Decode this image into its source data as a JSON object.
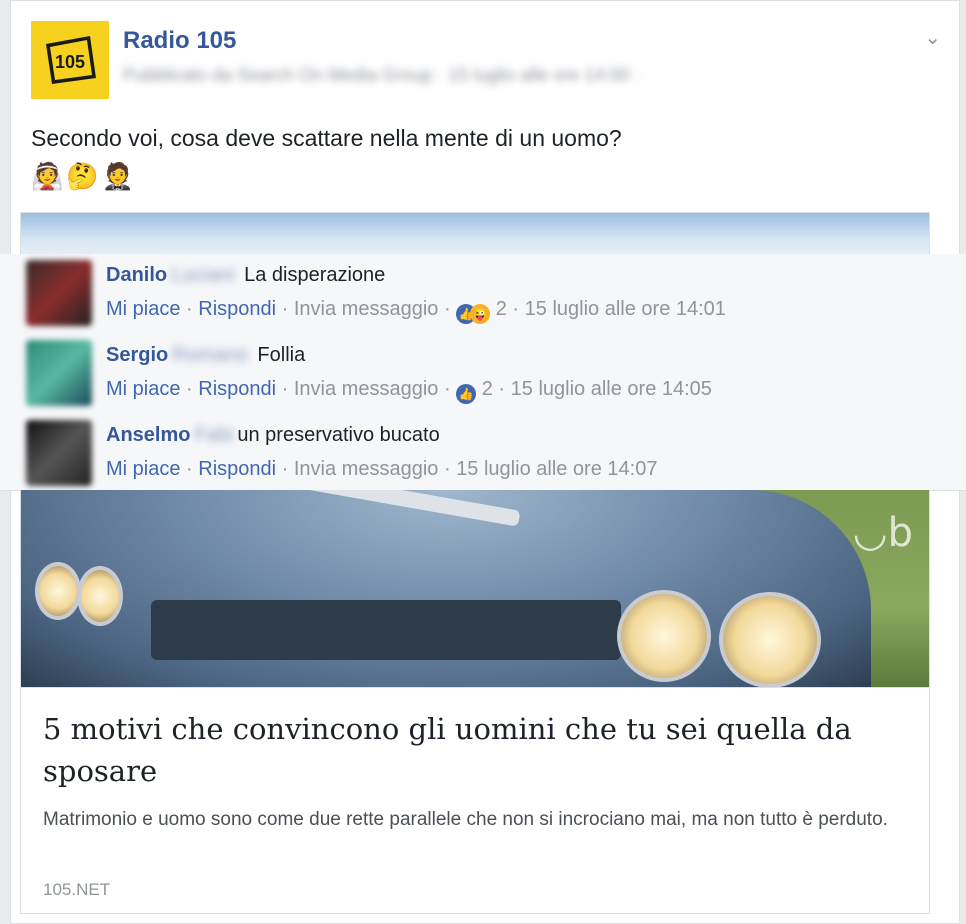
{
  "post": {
    "page_name": "Radio 105",
    "meta_text": "Pubblicato da Search On Media Group · 15 luglio alle ore 14:00 ·",
    "logo_text": "105",
    "text": "Secondo voi, cosa deve scattare nella mente di un uomo?",
    "emojis": "👰🤔🤵"
  },
  "comments": [
    {
      "author": "Danilo",
      "author_hidden": "Luciani",
      "text": "La disperazione",
      "actions": [
        "Mi piace",
        "Rispondi",
        "Invia messaggio"
      ],
      "reaction_count": "2",
      "time": "15 luglio alle ore 14:01"
    },
    {
      "author": "Sergio",
      "author_hidden": "Romano",
      "text": "Follia",
      "actions": [
        "Mi piace",
        "Rispondi",
        "Invia messaggio"
      ],
      "reaction_count": "2",
      "time": "15 luglio alle ore 14:05"
    },
    {
      "author": "Anselmo",
      "author_hidden": "Fabi",
      "text": "un preservativo bucato",
      "actions": [
        "Mi piace",
        "Rispondi",
        "Invia messaggio"
      ],
      "reaction_count": "",
      "time": "15 luglio alle ore 14:07"
    }
  ],
  "link": {
    "title": "5 motivi che convincono gli uomini che tu sei quella da sposare",
    "description": "Matrimonio e uomo sono come due rette parallele che non si incrociano mai, ma non tutto è perduto.",
    "domain": "105.NET"
  },
  "colors": {
    "facebook_blue": "#365899",
    "link_blue": "#4267b2",
    "muted": "#90949c",
    "brand_yellow": "#f6d21e"
  }
}
